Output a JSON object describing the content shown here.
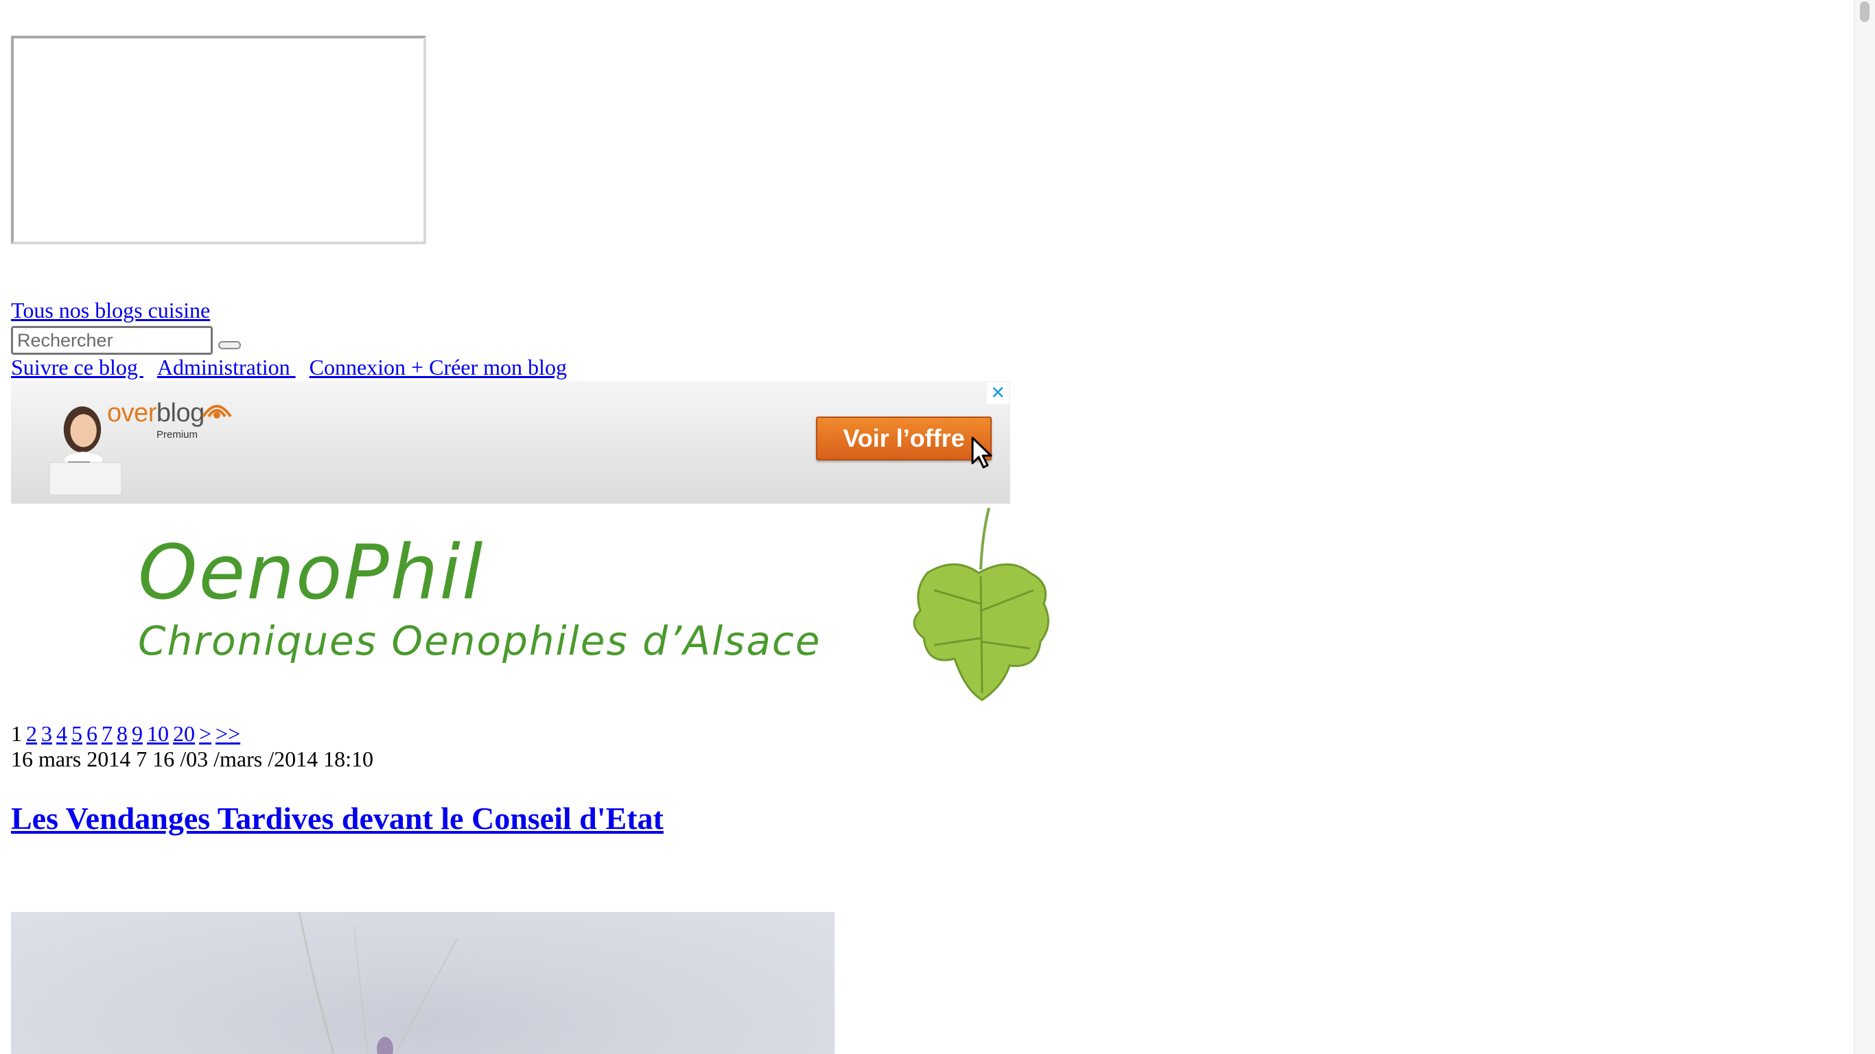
{
  "top_links": {
    "blogs_link": "Tous nos blogs cuisine"
  },
  "search": {
    "placeholder": "Rechercher"
  },
  "nav": {
    "follow": "Suivre ce blog ",
    "admin": "Administration ",
    "login": " Connexion + Créer mon blog"
  },
  "ad": {
    "brand_over": "over",
    "brand_blog": "blog",
    "premium": "Premium",
    "cta": "Voir l’offre",
    "close": "✕",
    "accent": "#e07a1f",
    "close_color": "#1a9fd6"
  },
  "blog": {
    "title": "OenoPhil",
    "subtitle": "Chroniques Oenophiles d’Alsace",
    "color": "#4a9a2e"
  },
  "pagination": {
    "current": "1",
    "pages": [
      "2",
      "3",
      "4",
      "5",
      "6",
      "7",
      "8",
      "9",
      "10",
      "20",
      ">",
      ">>"
    ]
  },
  "post": {
    "date": "16 mars 2014 7 16 /03 /mars /2014 18:10",
    "title": "Les Vendanges Tardives devant le Conseil d'Etat"
  }
}
